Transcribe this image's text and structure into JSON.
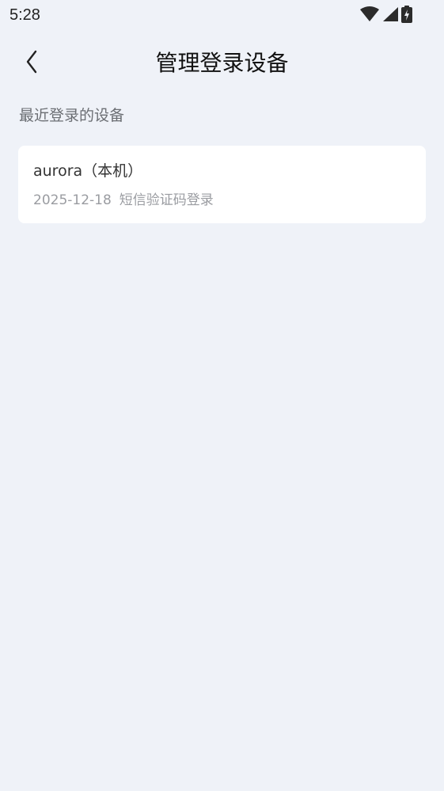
{
  "status_bar": {
    "time": "5:28",
    "icons": [
      "wifi-icon",
      "cellular-signal-icon",
      "battery-charging-icon"
    ]
  },
  "header": {
    "back_icon": "chevron-left-icon",
    "title": "管理登录设备"
  },
  "section": {
    "label": "最近登录的设备"
  },
  "devices": [
    {
      "name": "aurora（本机）",
      "date": "2025-12-18",
      "method": "短信验证码登录"
    }
  ],
  "colors": {
    "background": "#eff2f8",
    "card": "#ffffff",
    "title_text": "#111111",
    "secondary_text": "#9a9ca1"
  }
}
